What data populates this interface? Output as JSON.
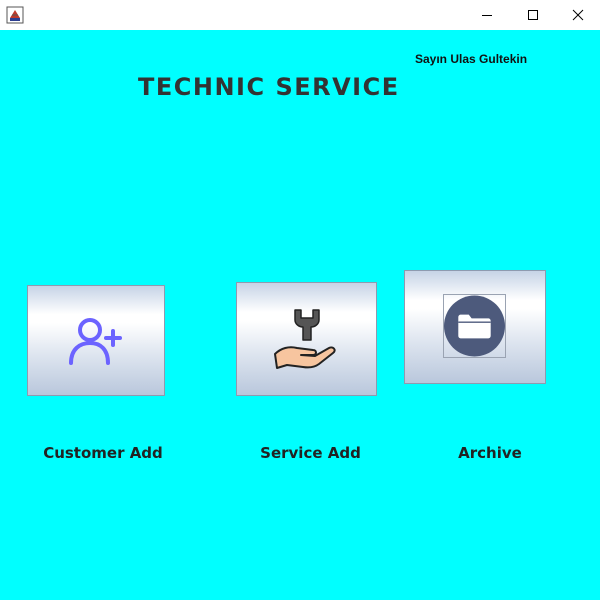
{
  "window": {
    "minimize_icon": "minimize-icon",
    "maximize_icon": "maximize-icon",
    "close_icon": "close-icon",
    "app_icon": "java-app-icon"
  },
  "header": {
    "user_greeting": "Sayın Ulas Gultekin",
    "title": "TECHNIC SERVICE"
  },
  "tiles": [
    {
      "caption": "Customer Add",
      "icon": "add-user-icon"
    },
    {
      "caption": "Service Add",
      "icon": "wrench-hand-icon"
    },
    {
      "caption": "Archive",
      "icon": "folder-icon"
    }
  ],
  "colors": {
    "background": "#00ffff",
    "titlebar": "#ffffff",
    "title_text": "#333333",
    "add_user_icon": "#6c63ff",
    "folder_circle": "#4d5a7c"
  }
}
